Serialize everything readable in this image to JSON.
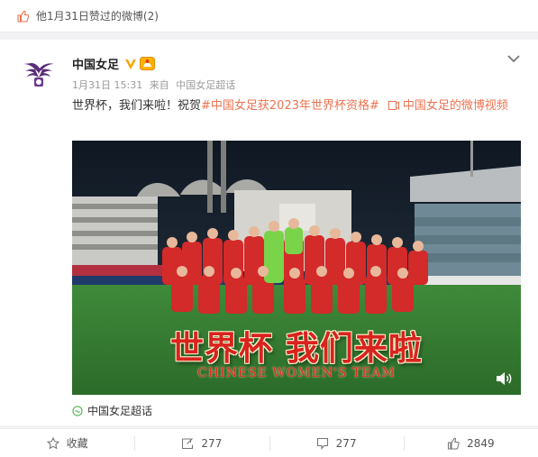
{
  "like_strip": {
    "text": "他1月31日赞过的微博(2)"
  },
  "post": {
    "author": "中国女足",
    "meta_time": "1月31日 15:31",
    "meta_from": "来自",
    "meta_source": "中国女足超话",
    "text_plain": "世界杯，我们来啦！祝贺",
    "hashtag": "#中国女足获2023年世界杯资格#",
    "video_link": "中国女足的微博视频",
    "video": {
      "title_cn": "世界杯 我们来啦",
      "title_en": "CHINESE WOMEN'S TEAM"
    },
    "topic": "中国女足超话"
  },
  "actions": {
    "favorite_label": "收藏",
    "repost_count": "277",
    "comment_count": "277",
    "like_count": "2849"
  },
  "icons": [
    "like-icon",
    "verified-icon",
    "badge-icon",
    "chevron-down-icon",
    "video-icon",
    "volume-icon",
    "topic-icon",
    "star-icon",
    "repost-icon",
    "comment-icon",
    "thumbs-up-icon"
  ],
  "colors": {
    "link": "#eb7350",
    "verified": "#f6a800",
    "brand": "#d8231f"
  }
}
